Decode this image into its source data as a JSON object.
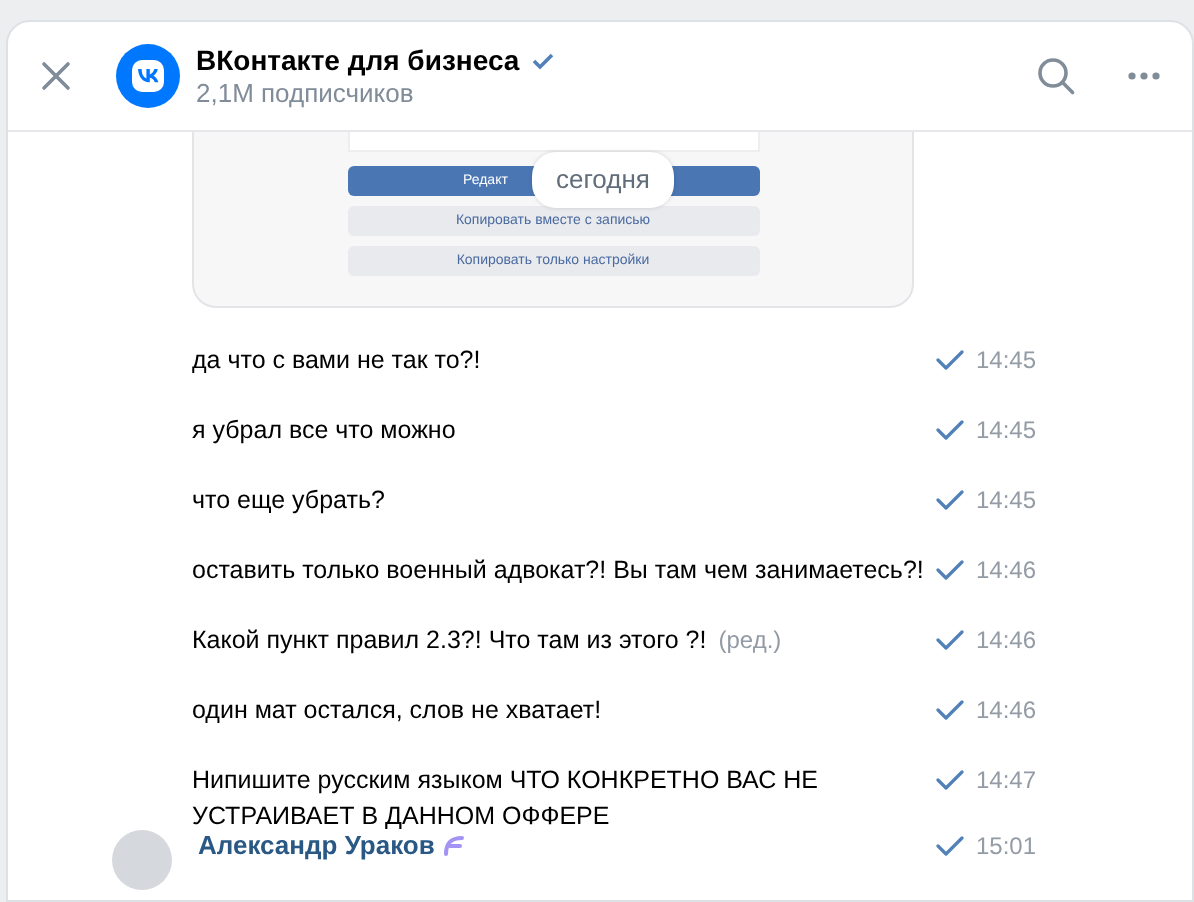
{
  "header": {
    "title": "ВКонтакте для бизнеса",
    "verified": true,
    "subtitle": "2,1M подписчиков"
  },
  "attachment": {
    "buttons": [
      {
        "label": "Редакт",
        "kind": "primary"
      },
      {
        "label": "Копировать вместе с записью",
        "kind": "secondary"
      },
      {
        "label": "Копировать только настройки",
        "kind": "secondary"
      }
    ]
  },
  "date_badge": "сегодня",
  "messages": [
    {
      "text": "да что с вами не так то?!",
      "time": "14:45",
      "read": true
    },
    {
      "text": "я убрал все что можно",
      "time": "14:45",
      "read": true
    },
    {
      "text": "что еще убрать?",
      "time": "14:45",
      "read": true
    },
    {
      "text": "оставить только военный адвокат?! Вы там чем занимаетесь?!",
      "time": "14:46",
      "read": true
    },
    {
      "text": "Какой пункт правил 2.3?! Что там из этого ?!",
      "edited": "(ред.)",
      "time": "14:46",
      "read": true
    },
    {
      "text": "один мат остался, слов не хватает!",
      "time": "14:46",
      "read": true
    },
    {
      "text": "Нипишите русским языком ЧТО КОНКРЕТНО ВАС НЕ УСТРАИВАЕТ В ДАННОМ ОФФЕРЕ",
      "time": "14:47",
      "read": true
    }
  ],
  "next_message": {
    "author": "Александр Ураков",
    "time": "15:01",
    "read": true
  }
}
